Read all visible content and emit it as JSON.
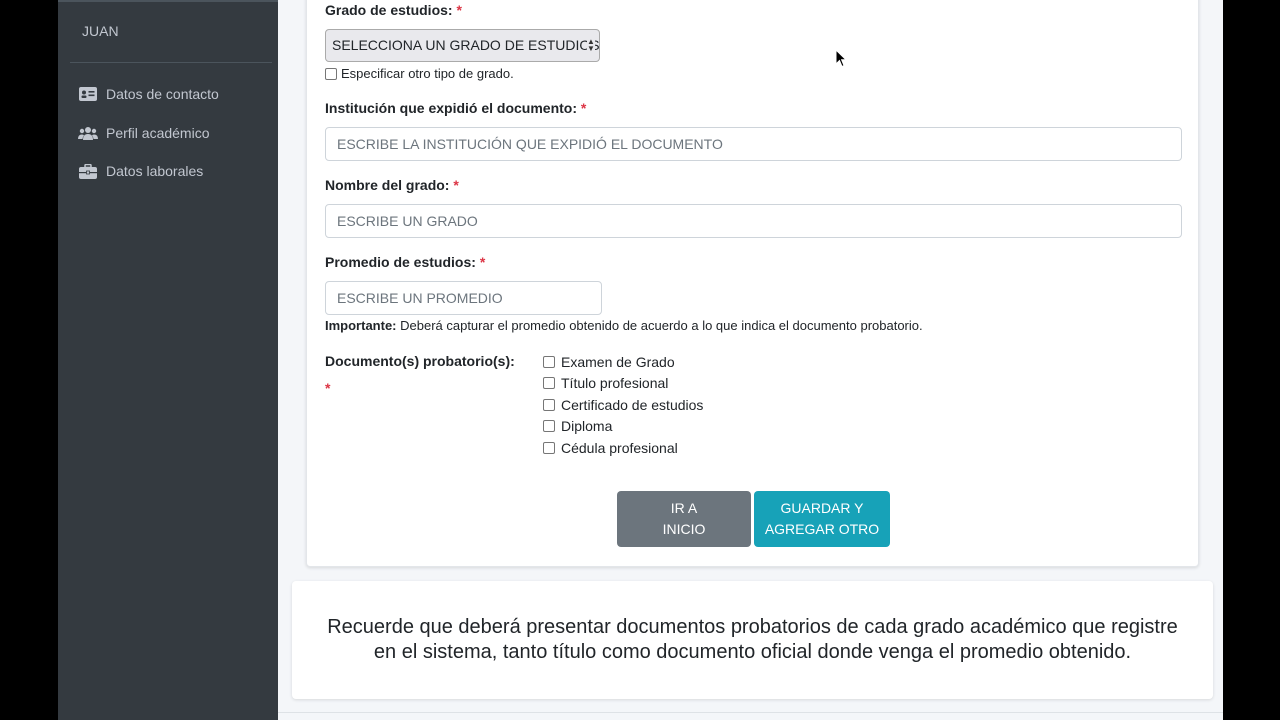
{
  "sidebar": {
    "user_name": "JUAN",
    "items": [
      {
        "label": "Datos de contacto",
        "icon": "id-card-icon"
      },
      {
        "label": "Perfil académico",
        "icon": "users-icon"
      },
      {
        "label": "Datos laborales",
        "icon": "briefcase-icon"
      }
    ]
  },
  "form": {
    "grado": {
      "label": "Grado de estudios:",
      "required_mark": "*",
      "select_value": "SELECCIONA UN GRADO DE ESTUDIOS",
      "other_checkbox_label": "Especificar otro tipo de grado."
    },
    "institucion": {
      "label": "Institución que expidió el documento:",
      "required_mark": "*",
      "placeholder": "ESCRIBE LA INSTITUCIÓN QUE EXPIDIÓ EL DOCUMENTO"
    },
    "nombre_grado": {
      "label": "Nombre del grado:",
      "required_mark": "*",
      "placeholder": "ESCRIBE UN GRADO"
    },
    "promedio": {
      "label": "Promedio de estudios:",
      "required_mark": "*",
      "placeholder": "ESCRIBE UN PROMEDIO",
      "note_bold": "Importante:",
      "note_text": " Deberá capturar el promedio obtenido de acuerdo a lo que indica el documento probatorio."
    },
    "documentos": {
      "label": "Documento(s) probatorio(s):",
      "required_mark": "*",
      "options": [
        "Examen de Grado",
        "Título profesional",
        "Certificado de estudios",
        "Diploma",
        "Cédula profesional"
      ]
    },
    "buttons": {
      "home_line1": "IR A",
      "home_line2": "INICIO",
      "save_line1": "GUARDAR Y",
      "save_line2": "AGREGAR OTRO"
    }
  },
  "notice": {
    "text": "Recuerde que deberá presentar documentos probatorios de cada grado académico que registre en el sistema, tanto título como documento oficial donde venga el promedio obtenido."
  },
  "colors": {
    "sidebar_bg": "#343a40",
    "required": "#dc3545",
    "btn_secondary": "#6c757d",
    "btn_info": "#17a2b8"
  }
}
